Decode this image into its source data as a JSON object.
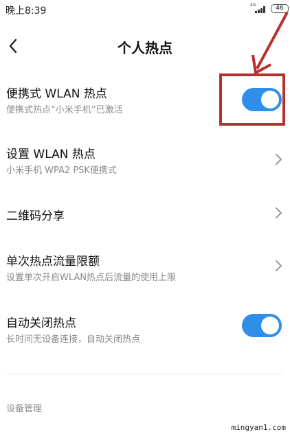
{
  "status_bar": {
    "time": "晚上8:39",
    "network": "4G",
    "battery": "46"
  },
  "header": {
    "title": "个人热点"
  },
  "settings": [
    {
      "title": "便携式 WLAN 热点",
      "subtitle": "便携式热点“小米手机”已激活",
      "control": "toggle",
      "state": true
    },
    {
      "title": "设置 WLAN 热点",
      "subtitle": "小米手机 WPA2 PSK便携式",
      "control": "chevron"
    },
    {
      "title": "二维码分享",
      "control": "chevron"
    },
    {
      "title": "单次热点流量限额",
      "subtitle": "设置单次开启WLAN热点后流量的使用上限",
      "control": "chevron"
    },
    {
      "title": "自动关闭热点",
      "subtitle": "长时间无设备连接，自动关闭热点",
      "control": "toggle",
      "state": true
    }
  ],
  "section": {
    "label": "设备管理"
  },
  "watermark": "mingyan1.com",
  "colors": {
    "toggle_on": "#2f8fe8",
    "annotation": "#b8302c"
  }
}
